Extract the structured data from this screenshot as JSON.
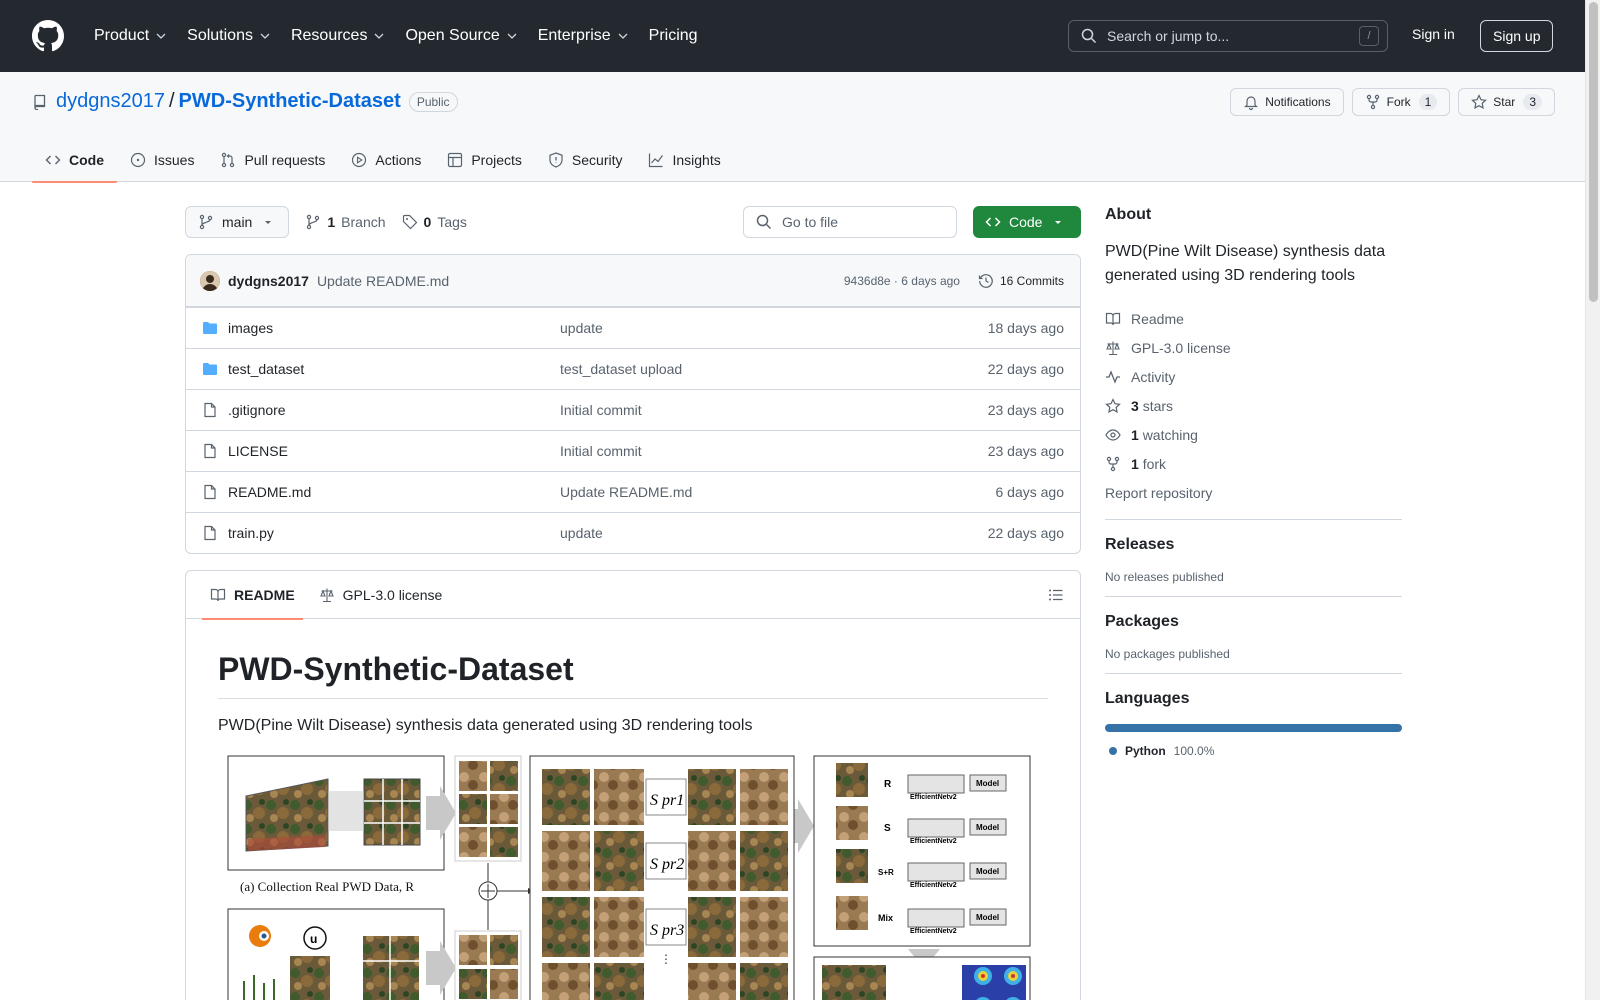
{
  "header": {
    "nav": [
      "Product",
      "Solutions",
      "Resources",
      "Open Source",
      "Enterprise",
      "Pricing"
    ],
    "search_placeholder": "Search or jump to...",
    "search_shortcut": "/",
    "sign_in": "Sign in",
    "sign_up": "Sign up"
  },
  "repo": {
    "owner": "dydgns2017",
    "separator": "/",
    "name": "PWD-Synthetic-Dataset",
    "visibility": "Public",
    "notifications": "Notifications",
    "fork_label": "Fork",
    "fork_count": "1",
    "star_label": "Star",
    "star_count": "3",
    "tabs": [
      "Code",
      "Issues",
      "Pull requests",
      "Actions",
      "Projects",
      "Security",
      "Insights"
    ]
  },
  "toolbar": {
    "branch": "main",
    "branch_count": "1",
    "branch_label": "Branch",
    "tag_count": "0",
    "tag_label": "Tags",
    "goto_placeholder": "Go to file",
    "code_button": "Code"
  },
  "commit": {
    "user": "dydgns2017",
    "message": "Update README.md",
    "hash": "9436d8e",
    "dot": " · ",
    "age": "6 days ago",
    "commits": "16 Commits"
  },
  "files": [
    {
      "name": "images",
      "type": "dir",
      "commit": "update",
      "age": "18 days ago"
    },
    {
      "name": "test_dataset",
      "type": "dir",
      "commit": "test_dataset upload",
      "age": "22 days ago"
    },
    {
      "name": ".gitignore",
      "type": "file",
      "commit": "Initial commit",
      "age": "23 days ago"
    },
    {
      "name": "LICENSE",
      "type": "file",
      "commit": "Initial commit",
      "age": "23 days ago"
    },
    {
      "name": "README.md",
      "type": "file",
      "commit": "Update README.md",
      "age": "6 days ago"
    },
    {
      "name": "train.py",
      "type": "file",
      "commit": "update",
      "age": "22 days ago"
    }
  ],
  "readme": {
    "tab_readme": "README",
    "tab_license": "GPL-3.0 license",
    "title": "PWD-Synthetic-Dataset",
    "description": "PWD(Pine Wilt Disease) synthesis data generated using 3D rendering tools",
    "figure": {
      "caption_a": "(a) Collection Real PWD Data, R",
      "labels": [
        "R",
        "S",
        "S+R",
        "Mix"
      ],
      "model_label": "Model",
      "net_label": "EfficientNetv2",
      "spr": [
        "S pr1",
        "S pr2",
        "S pr3"
      ]
    }
  },
  "about": {
    "heading": "About",
    "description": "PWD(Pine Wilt Disease) synthesis data generated using 3D rendering tools",
    "readme": "Readme",
    "license": "GPL-3.0 license",
    "activity": "Activity",
    "stars_count": "3",
    "stars_label": "stars",
    "watching_count": "1",
    "watching_label": "watching",
    "fork_count": "1",
    "fork_label": "fork",
    "report": "Report repository"
  },
  "releases": {
    "heading": "Releases",
    "text": "No releases published"
  },
  "packages": {
    "heading": "Packages",
    "text": "No packages published"
  },
  "languages": {
    "heading": "Languages",
    "name": "Python",
    "percent": "100.0%",
    "color": "#3572A5"
  },
  "colors": {
    "header_bg": "#24292f",
    "link": "#0969da",
    "green": "#1f883d",
    "tab_underline": "#fd8c73"
  }
}
